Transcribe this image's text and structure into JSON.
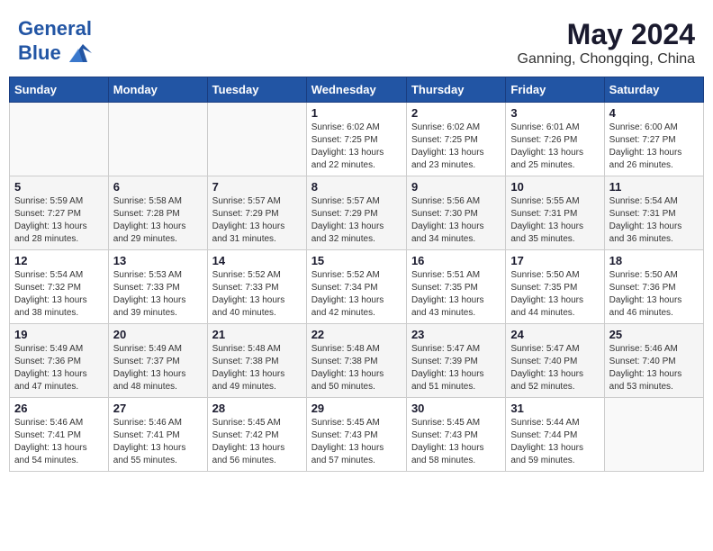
{
  "header": {
    "logo_line1": "General",
    "logo_line2": "Blue",
    "month": "May 2024",
    "location": "Ganning, Chongqing, China"
  },
  "weekdays": [
    "Sunday",
    "Monday",
    "Tuesday",
    "Wednesday",
    "Thursday",
    "Friday",
    "Saturday"
  ],
  "weeks": [
    [
      {
        "day": "",
        "info": ""
      },
      {
        "day": "",
        "info": ""
      },
      {
        "day": "",
        "info": ""
      },
      {
        "day": "1",
        "info": "Sunrise: 6:02 AM\nSunset: 7:25 PM\nDaylight: 13 hours\nand 22 minutes."
      },
      {
        "day": "2",
        "info": "Sunrise: 6:02 AM\nSunset: 7:25 PM\nDaylight: 13 hours\nand 23 minutes."
      },
      {
        "day": "3",
        "info": "Sunrise: 6:01 AM\nSunset: 7:26 PM\nDaylight: 13 hours\nand 25 minutes."
      },
      {
        "day": "4",
        "info": "Sunrise: 6:00 AM\nSunset: 7:27 PM\nDaylight: 13 hours\nand 26 minutes."
      }
    ],
    [
      {
        "day": "5",
        "info": "Sunrise: 5:59 AM\nSunset: 7:27 PM\nDaylight: 13 hours\nand 28 minutes."
      },
      {
        "day": "6",
        "info": "Sunrise: 5:58 AM\nSunset: 7:28 PM\nDaylight: 13 hours\nand 29 minutes."
      },
      {
        "day": "7",
        "info": "Sunrise: 5:57 AM\nSunset: 7:29 PM\nDaylight: 13 hours\nand 31 minutes."
      },
      {
        "day": "8",
        "info": "Sunrise: 5:57 AM\nSunset: 7:29 PM\nDaylight: 13 hours\nand 32 minutes."
      },
      {
        "day": "9",
        "info": "Sunrise: 5:56 AM\nSunset: 7:30 PM\nDaylight: 13 hours\nand 34 minutes."
      },
      {
        "day": "10",
        "info": "Sunrise: 5:55 AM\nSunset: 7:31 PM\nDaylight: 13 hours\nand 35 minutes."
      },
      {
        "day": "11",
        "info": "Sunrise: 5:54 AM\nSunset: 7:31 PM\nDaylight: 13 hours\nand 36 minutes."
      }
    ],
    [
      {
        "day": "12",
        "info": "Sunrise: 5:54 AM\nSunset: 7:32 PM\nDaylight: 13 hours\nand 38 minutes."
      },
      {
        "day": "13",
        "info": "Sunrise: 5:53 AM\nSunset: 7:33 PM\nDaylight: 13 hours\nand 39 minutes."
      },
      {
        "day": "14",
        "info": "Sunrise: 5:52 AM\nSunset: 7:33 PM\nDaylight: 13 hours\nand 40 minutes."
      },
      {
        "day": "15",
        "info": "Sunrise: 5:52 AM\nSunset: 7:34 PM\nDaylight: 13 hours\nand 42 minutes."
      },
      {
        "day": "16",
        "info": "Sunrise: 5:51 AM\nSunset: 7:35 PM\nDaylight: 13 hours\nand 43 minutes."
      },
      {
        "day": "17",
        "info": "Sunrise: 5:50 AM\nSunset: 7:35 PM\nDaylight: 13 hours\nand 44 minutes."
      },
      {
        "day": "18",
        "info": "Sunrise: 5:50 AM\nSunset: 7:36 PM\nDaylight: 13 hours\nand 46 minutes."
      }
    ],
    [
      {
        "day": "19",
        "info": "Sunrise: 5:49 AM\nSunset: 7:36 PM\nDaylight: 13 hours\nand 47 minutes."
      },
      {
        "day": "20",
        "info": "Sunrise: 5:49 AM\nSunset: 7:37 PM\nDaylight: 13 hours\nand 48 minutes."
      },
      {
        "day": "21",
        "info": "Sunrise: 5:48 AM\nSunset: 7:38 PM\nDaylight: 13 hours\nand 49 minutes."
      },
      {
        "day": "22",
        "info": "Sunrise: 5:48 AM\nSunset: 7:38 PM\nDaylight: 13 hours\nand 50 minutes."
      },
      {
        "day": "23",
        "info": "Sunrise: 5:47 AM\nSunset: 7:39 PM\nDaylight: 13 hours\nand 51 minutes."
      },
      {
        "day": "24",
        "info": "Sunrise: 5:47 AM\nSunset: 7:40 PM\nDaylight: 13 hours\nand 52 minutes."
      },
      {
        "day": "25",
        "info": "Sunrise: 5:46 AM\nSunset: 7:40 PM\nDaylight: 13 hours\nand 53 minutes."
      }
    ],
    [
      {
        "day": "26",
        "info": "Sunrise: 5:46 AM\nSunset: 7:41 PM\nDaylight: 13 hours\nand 54 minutes."
      },
      {
        "day": "27",
        "info": "Sunrise: 5:46 AM\nSunset: 7:41 PM\nDaylight: 13 hours\nand 55 minutes."
      },
      {
        "day": "28",
        "info": "Sunrise: 5:45 AM\nSunset: 7:42 PM\nDaylight: 13 hours\nand 56 minutes."
      },
      {
        "day": "29",
        "info": "Sunrise: 5:45 AM\nSunset: 7:43 PM\nDaylight: 13 hours\nand 57 minutes."
      },
      {
        "day": "30",
        "info": "Sunrise: 5:45 AM\nSunset: 7:43 PM\nDaylight: 13 hours\nand 58 minutes."
      },
      {
        "day": "31",
        "info": "Sunrise: 5:44 AM\nSunset: 7:44 PM\nDaylight: 13 hours\nand 59 minutes."
      },
      {
        "day": "",
        "info": ""
      }
    ]
  ]
}
